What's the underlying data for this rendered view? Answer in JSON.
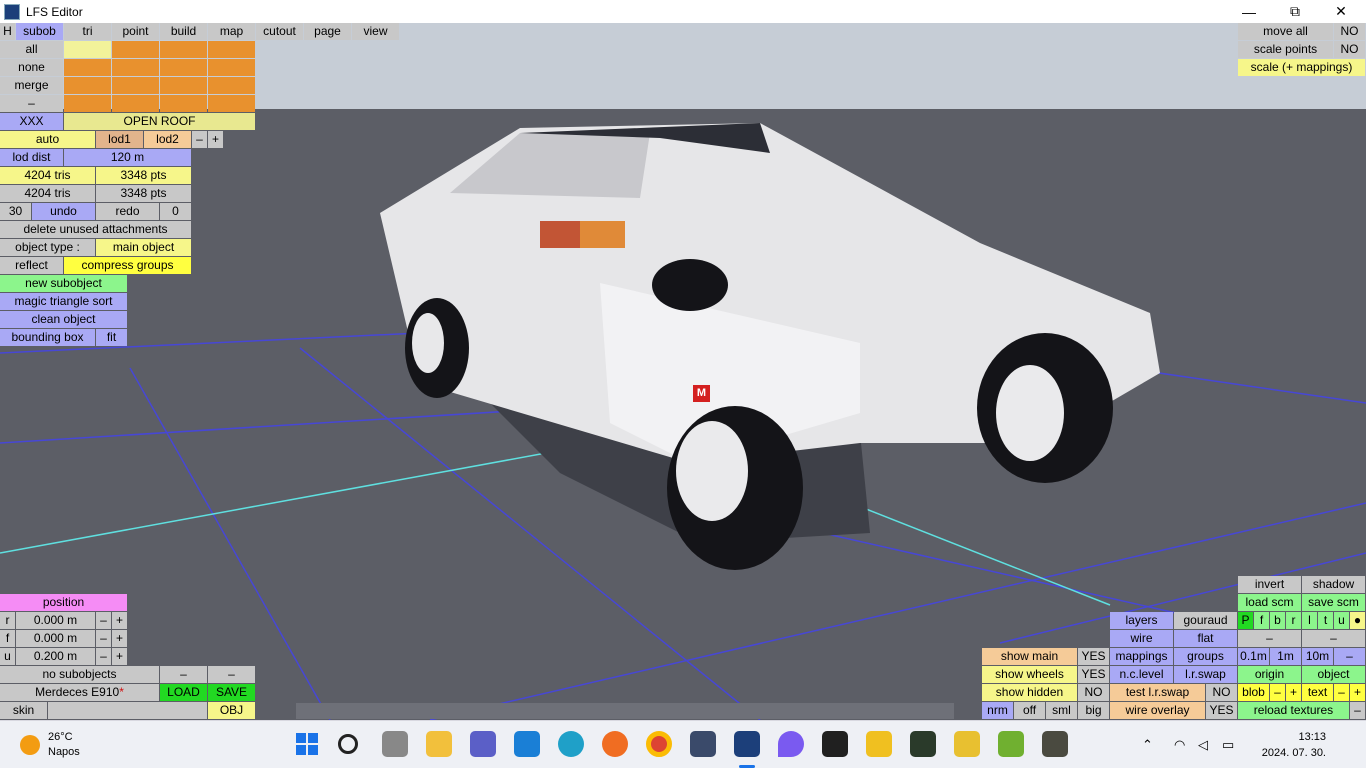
{
  "window": {
    "title": "LFS Editor",
    "minimize": "—",
    "maximize": "⧉",
    "close": "✕"
  },
  "topbar": {
    "h": "H",
    "subob": "subob",
    "tri": "tri",
    "point": "point",
    "build": "build",
    "map": "map",
    "cutout": "cutout",
    "page": "page",
    "view": "view"
  },
  "left": {
    "all": "all",
    "none": "none",
    "merge": "merge",
    "dash": "–",
    "xxx": "XXX",
    "open_roof": "OPEN ROOF",
    "auto": "auto",
    "lod1": "lod1",
    "lod2": "lod2",
    "minus": "–",
    "plus": "+",
    "lod_dist": "lod dist",
    "lod_dist_val": "120 m",
    "tris1": "4204 tris",
    "pts1": "3348 pts",
    "tris2": "4204 tris",
    "pts2": "3348 pts",
    "undo_count": "30",
    "undo": "undo",
    "redo": "redo",
    "redo_count": "0",
    "delete_unused": "delete unused attachments",
    "object_type": "object type :",
    "object_type_val": "main object",
    "reflect": "reflect",
    "compress_groups": "compress groups",
    "new_subobject": "new subobject",
    "magic_sort": "magic triangle sort",
    "clean_object": "clean object",
    "bounding_box": "bounding box",
    "fit": "fit"
  },
  "position": {
    "header": "position",
    "rows": [
      {
        "axis": "r",
        "value": "0.000 m"
      },
      {
        "axis": "f",
        "value": "0.000 m"
      },
      {
        "axis": "u",
        "value": "0.200 m"
      }
    ],
    "minus": "–",
    "plus": "+"
  },
  "bottom_left": {
    "no_subobjects": "no subobjects",
    "dash": "–",
    "car_name": "Merdeces E910",
    "modified_mark": "*",
    "load": "LOAD",
    "save": "SAVE",
    "skin": "skin",
    "obj": "OBJ"
  },
  "top_right": {
    "move_all": "move all",
    "move_all_val": "NO",
    "scale_points": "scale points",
    "scale_points_val": "NO",
    "scale_mappings": "scale (+ mappings)"
  },
  "bottom_right": {
    "invert": "invert",
    "shadow": "shadow",
    "load_scm": "load scm",
    "save_scm": "save scm",
    "layers": "layers",
    "gouraud": "gouraud",
    "wire": "wire",
    "flat": "flat",
    "p_letters": [
      "P",
      "f",
      "b",
      "r",
      "l",
      "t",
      "u",
      "●"
    ],
    "dash": "–",
    "show_main": "show main",
    "show_main_val": "YES",
    "show_wheels": "show wheels",
    "show_wheels_val": "YES",
    "show_hidden": "show hidden",
    "show_hidden_val": "NO",
    "mappings": "mappings",
    "groups": "groups",
    "n_c_level": "n.c.level",
    "l_r_swap": "l.r.swap",
    "test_lr_swap": "test l.r.swap",
    "test_lr_swap_val": "NO",
    "wire_overlay": "wire overlay",
    "wire_overlay_val": "YES",
    "nrm": "nrm",
    "off": "off",
    "sml": "sml",
    "big": "big",
    "step_01": "0.1m",
    "step_1": "1m",
    "step_10": "10m",
    "origin": "origin",
    "object": "object",
    "blob": "blob",
    "text": "text",
    "plus": "+",
    "reload_textures": "reload textures"
  },
  "viewport": {
    "marker": "M"
  },
  "taskbar": {
    "temp": "26°C",
    "weather": "Napos",
    "time": "13:13",
    "date": "2024. 07. 30."
  }
}
